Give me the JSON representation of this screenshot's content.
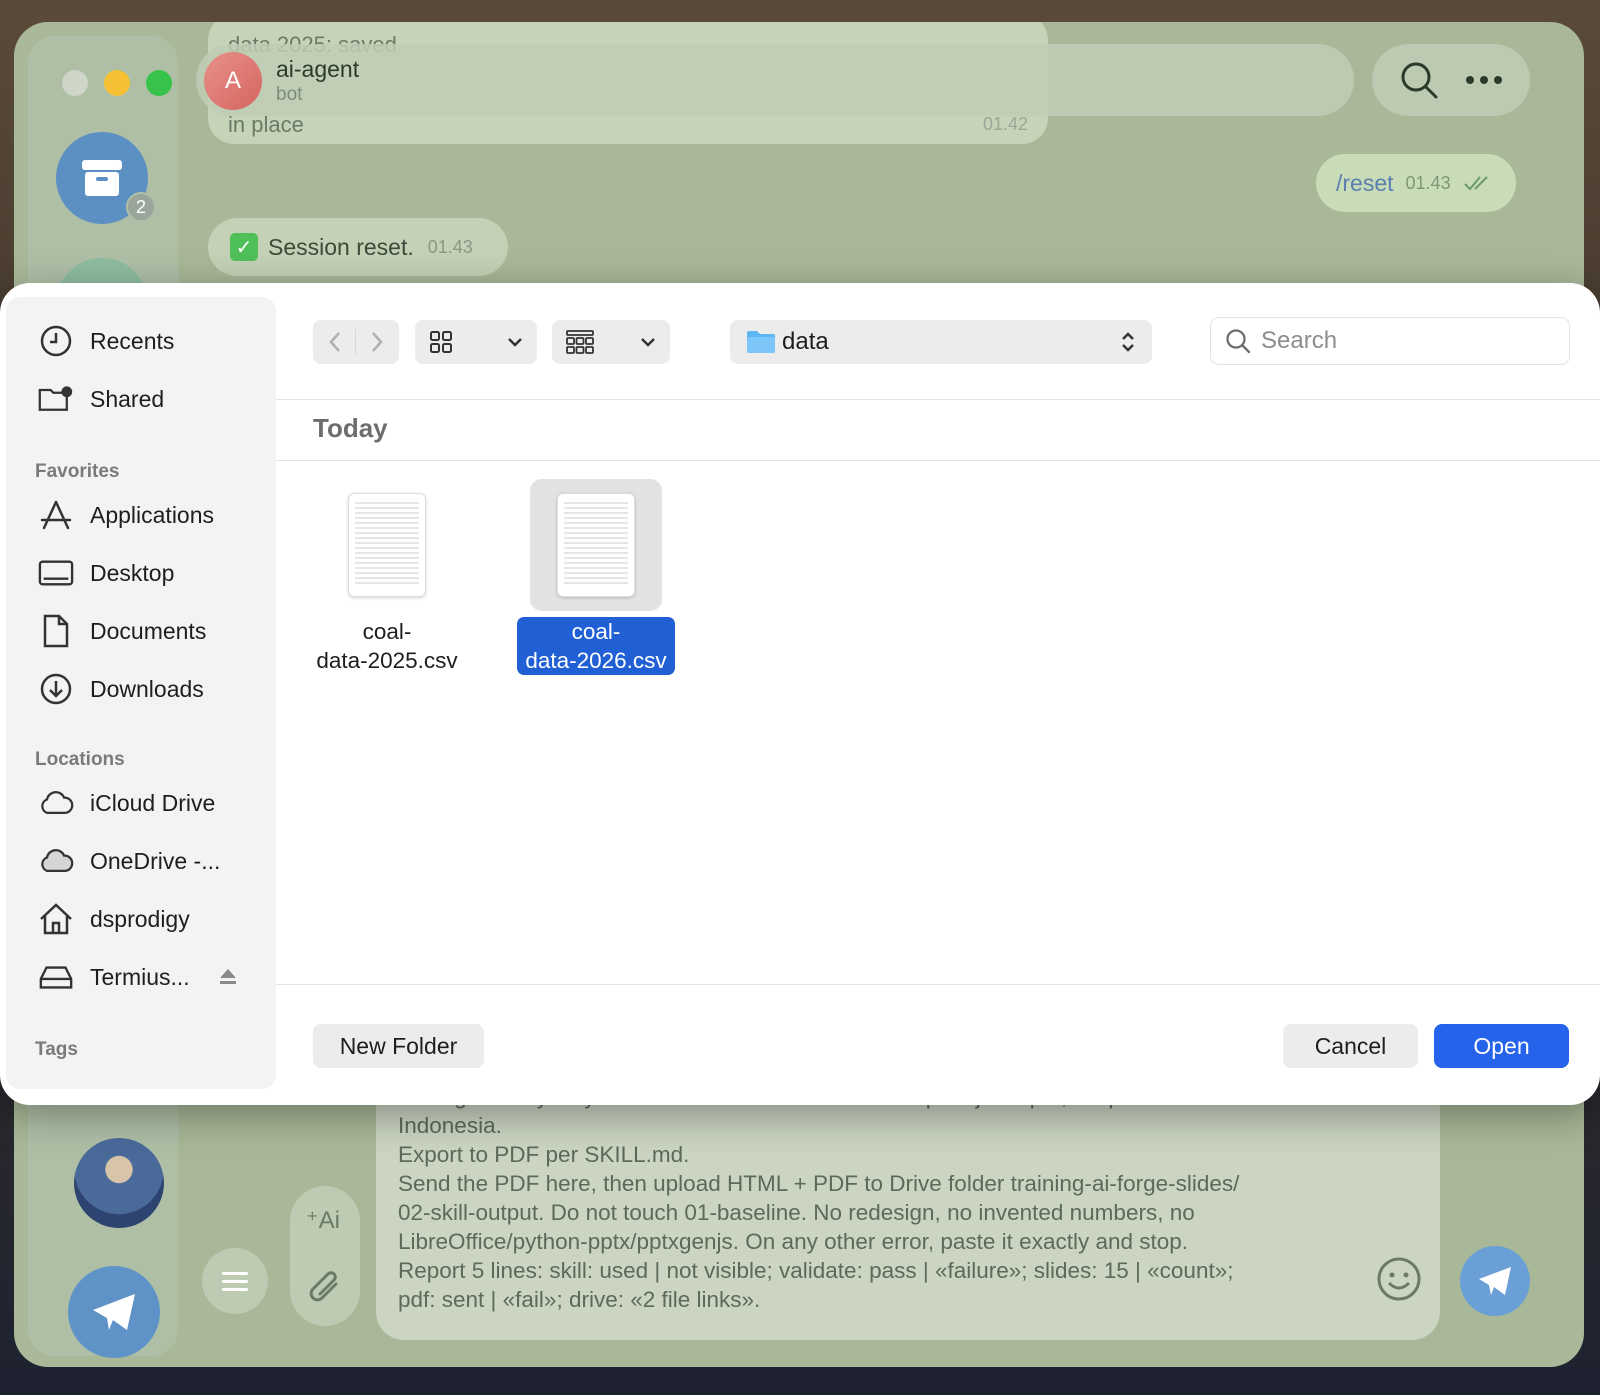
{
  "telegram": {
    "sidebar": {
      "folder_badge": "2"
    },
    "header": {
      "avatar_letter": "A",
      "name": "ai-agent",
      "subtitle": "bot"
    },
    "messages": {
      "top_line1": "data 2025: saved",
      "top_line2": "in place",
      "top_time": "01.42",
      "reset_cmd": "/reset",
      "reset_time": "01.43",
      "session_text": "Session reset.",
      "session_time": "01.43"
    },
    "composer": {
      "ai_label": "⁺Ai",
      "text": "chart geometry only from the validated CSV and compute.js output, simple Bahasa\nIndonesia.\nExport to PDF per SKILL.md.\nSend the PDF here, then upload HTML + PDF to Drive folder training-ai-forge-slides/\n02-skill-output. Do not touch 01-baseline. No redesign, no invented numbers, no\nLibreOffice/python-pptx/pptxgenjs. On any other error, paste it exactly and stop.\nReport 5 lines: skill: used | not visible; validate: pass | «failure»; slides: 15 | «count»;\npdf: sent | «fail»; drive: «2 file links»."
    }
  },
  "dialog": {
    "sidebar": {
      "top_items": [
        {
          "label": "Recents",
          "icon": "clock-icon"
        },
        {
          "label": "Shared",
          "icon": "shared-folder-icon"
        }
      ],
      "favorites_title": "Favorites",
      "favorites": [
        {
          "label": "Applications",
          "icon": "applications-icon"
        },
        {
          "label": "Desktop",
          "icon": "desktop-icon"
        },
        {
          "label": "Documents",
          "icon": "document-icon"
        },
        {
          "label": "Downloads",
          "icon": "download-icon"
        }
      ],
      "locations_title": "Locations",
      "locations": [
        {
          "label": "iCloud Drive",
          "icon": "cloud-icon"
        },
        {
          "label": "OneDrive -...",
          "icon": "onedrive-cloud-icon"
        },
        {
          "label": "dsprodigy",
          "icon": "home-icon"
        },
        {
          "label": "Termius...",
          "icon": "drive-icon"
        }
      ],
      "tags_title": "Tags"
    },
    "toolbar": {
      "path": "data",
      "search_placeholder": "Search"
    },
    "section_title": "Today",
    "files": [
      {
        "name_line1": "coal-",
        "name_line2": "data-2025.csv",
        "selected": false
      },
      {
        "name_line1": "coal-",
        "name_line2": "data-2026.csv",
        "selected": true
      }
    ],
    "buttons": {
      "new_folder": "New Folder",
      "cancel": "Cancel",
      "open": "Open"
    },
    "colors": {
      "accent": "#2563eb",
      "selection": "#2160d4"
    }
  }
}
